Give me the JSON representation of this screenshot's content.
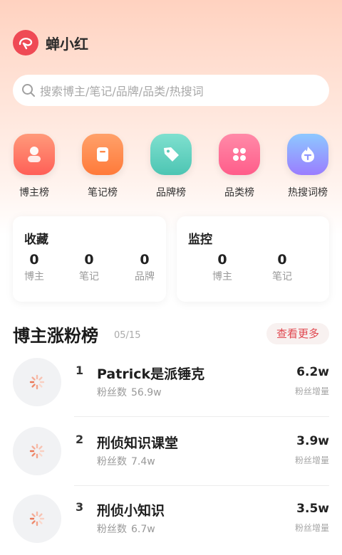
{
  "app": {
    "title": "蝉小红"
  },
  "search": {
    "placeholder": "搜索博主/笔记/品牌/品类/热搜词"
  },
  "categories": [
    {
      "label": "博主榜",
      "icon": "person-icon",
      "color_from": "#ff9a7a",
      "color_to": "#ff5f57"
    },
    {
      "label": "笔记榜",
      "icon": "note-icon",
      "color_from": "#ffa16a",
      "color_to": "#ff7a3a"
    },
    {
      "label": "品牌榜",
      "icon": "tag-icon",
      "color_from": "#7fe0cf",
      "color_to": "#4dc5b3"
    },
    {
      "label": "品类榜",
      "icon": "grid-icon",
      "color_from": "#ff8aa8",
      "color_to": "#ff5d8a"
    },
    {
      "label": "热搜词榜",
      "icon": "fire-icon",
      "color_from": "#8dc8ff",
      "color_to": "#9a7dff"
    }
  ],
  "favorites": {
    "title": "收藏",
    "stats": [
      {
        "value": "0",
        "label": "博主"
      },
      {
        "value": "0",
        "label": "笔记"
      },
      {
        "value": "0",
        "label": "品牌"
      }
    ]
  },
  "monitor": {
    "title": "监控",
    "stats": [
      {
        "value": "0",
        "label": "博主"
      },
      {
        "value": "0",
        "label": "笔记"
      }
    ]
  },
  "ranking": {
    "title": "博主涨粉榜",
    "date": "05/15",
    "more_label": "查看更多",
    "fans_label": "粉丝数",
    "gain_label": "粉丝增量",
    "items": [
      {
        "rank": "1",
        "name": "Patrick是派锤克",
        "fans": "56.9w",
        "gain": "6.2w"
      },
      {
        "rank": "2",
        "name": "刑侦知识课堂",
        "fans": "7.4w",
        "gain": "3.9w"
      },
      {
        "rank": "3",
        "name": "刑侦小知识",
        "fans": "6.7w",
        "gain": "3.5w"
      }
    ]
  },
  "colors": {
    "accent": "#e0474f",
    "logo": "#ef4a55"
  }
}
